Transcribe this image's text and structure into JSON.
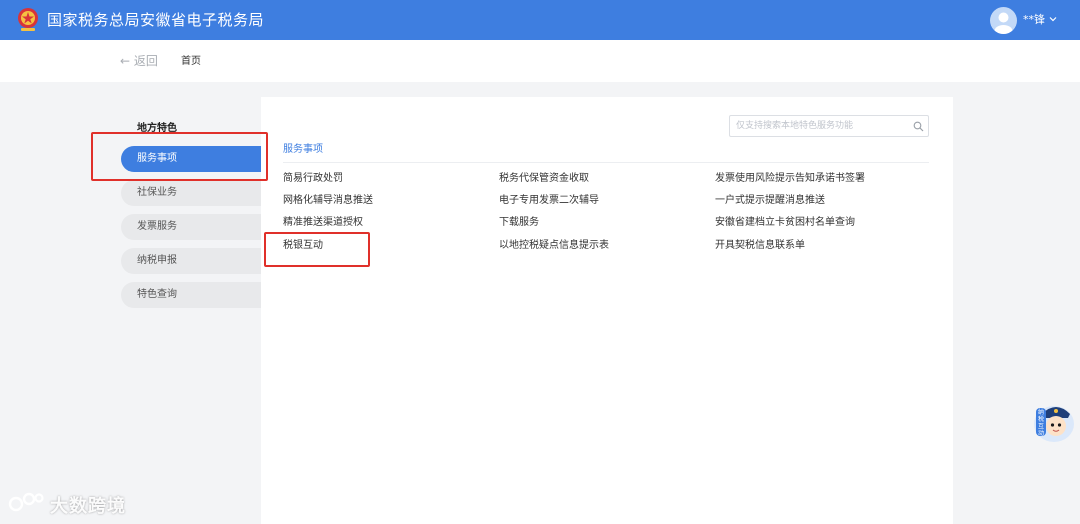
{
  "header": {
    "site_title": "国家税务总局安徽省电子税务局",
    "user_name": "**锋",
    "brand_color": "#3e7ee0",
    "emblem_icon": "tax-emblem-icon",
    "avatar_icon": "user-avatar-icon"
  },
  "breadcrumb": {
    "back_label": "← 返回",
    "home_label": "首页"
  },
  "sidebar": {
    "heading": "地方特色",
    "items": [
      {
        "label": "服务事项",
        "active": true
      },
      {
        "label": "社保业务",
        "active": false
      },
      {
        "label": "发票服务",
        "active": false
      },
      {
        "label": "纳税申报",
        "active": false
      },
      {
        "label": "特色查询",
        "active": false
      }
    ]
  },
  "main": {
    "search": {
      "placeholder": "仅支持搜索本地特色服务功能",
      "value": ""
    },
    "section_title": "服务事项",
    "columns": [
      [
        "简易行政处罚",
        "网格化辅导消息推送",
        "精准推送渠道授权",
        "税银互动"
      ],
      [
        "税务代保管资金收取",
        "电子专用发票二次辅导",
        "下载服务",
        "以地控税疑点信息提示表"
      ],
      [
        "发票使用风险提示告知承诺书签署",
        "一户式提示提醒消息推送",
        "安徽省建档立卡贫困村名单查询",
        "开具契税信息联系单"
      ]
    ]
  },
  "annotations": {
    "highlight_color": "#e0302a"
  },
  "mascot": {
    "label": "纳税互动"
  },
  "watermark": {
    "text": "大数跨境"
  }
}
